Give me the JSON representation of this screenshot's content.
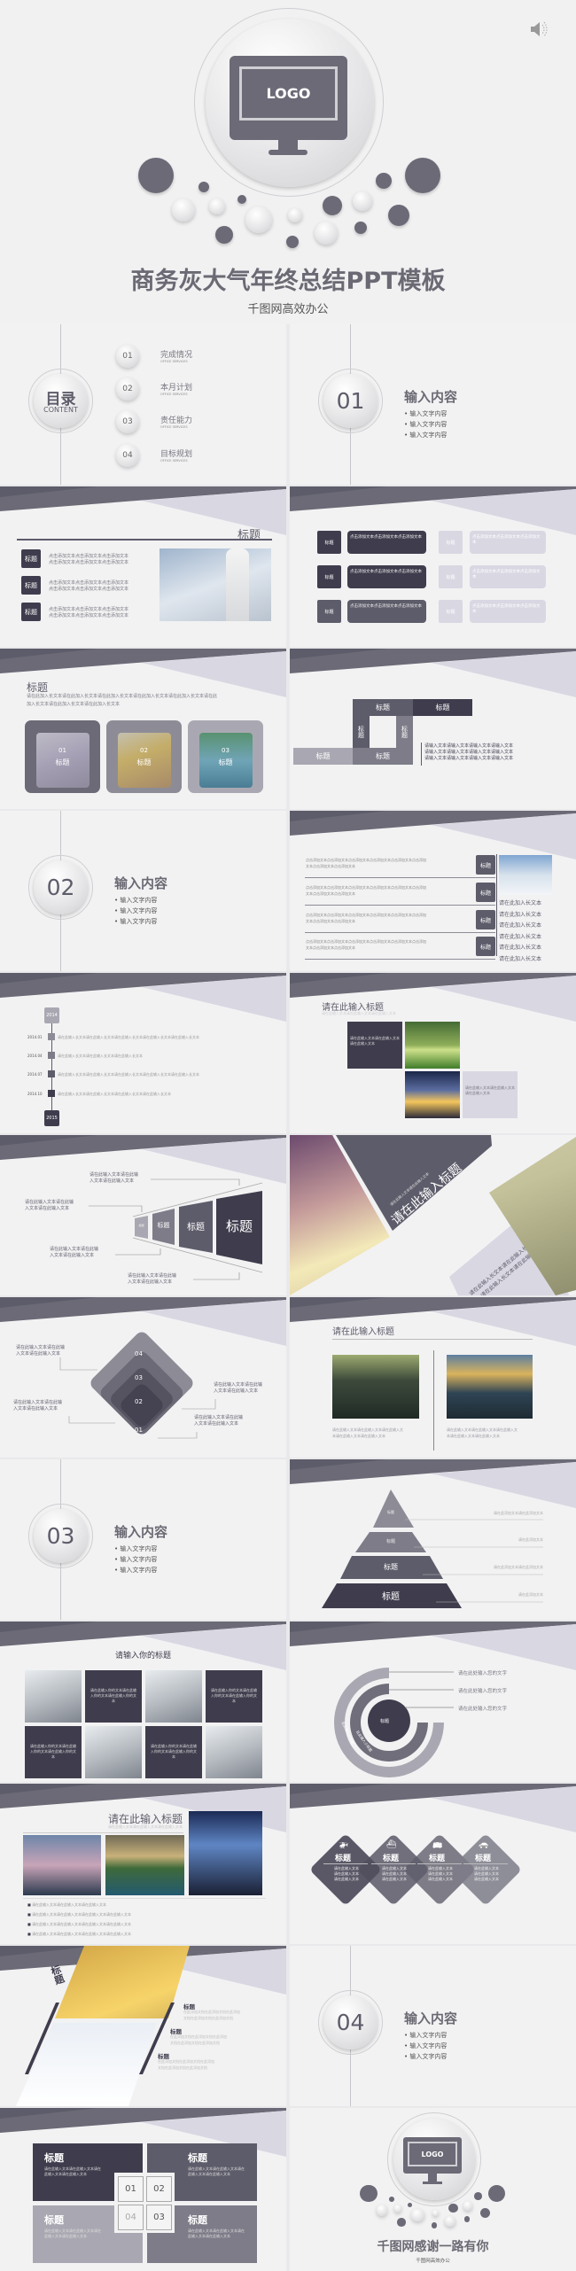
{
  "cover": {
    "logo": "LOGO",
    "title": "商务灰大气年终总结PPT模板",
    "subtitle": "千图网高效办公",
    "speaker_icon": "speaker-icon"
  },
  "colors": {
    "dark": "#3f3d4d",
    "mid": "#5d5c6a",
    "gray": "#7d7c88",
    "light": "#a9a8b2",
    "lavender": "#d9d7e2",
    "background": "#f2f2f3"
  },
  "common": {
    "title": "标题"
  },
  "toc": {
    "title": "目录",
    "subtitle": "CONTENT",
    "items": [
      {
        "num": "01",
        "label": "完成情况",
        "en": "OFFICE SERVICES"
      },
      {
        "num": "02",
        "label": "本月计划",
        "en": "OFFICE SERVICES"
      },
      {
        "num": "03",
        "label": "责任能力",
        "en": "OFFICE SERVICES"
      },
      {
        "num": "04",
        "label": "目标规划",
        "en": "OFFICE SERVICES"
      }
    ]
  },
  "section": {
    "heading": "输入内容",
    "bullet": "• 输入文字内容",
    "nums": [
      "01",
      "02",
      "03",
      "04"
    ]
  },
  "s2": {
    "line": "点击添加文本点击添加文本点击添加文本",
    "box_text": "点击添加文本点击添加文本点击添加文本"
  },
  "s3": {
    "para1": "请在此加入长文本请在此加入长文本请在此加入长文本请在此加入长文本请在此加入长文本请在此",
    "para2": "加入长文本请在此加入长文本请在此加入长文本",
    "cards": [
      "01",
      "02",
      "03"
    ],
    "side": "请输入文本请输入文本请输入文本请输入文本"
  },
  "s4": {
    "row1": "点击添加文本点击添加文本点击添加文本点击添加文本点击添加文本点击添加",
    "row2": "文本点击添加文本点击添加文本",
    "side": "请在此加入长文本"
  },
  "s5": {
    "start": "2014",
    "end": "2015",
    "events": [
      {
        "date": "2014.01",
        "text": "请在此输入长文本请在此输入长文本请在此输入长文本请在此输入长文本请在此输入长文本"
      },
      {
        "date": "2014.04",
        "text": "请在此输入长文本请在此输入长文本请在此输入长文本"
      },
      {
        "date": "2014.07",
        "text": "请在此输入长文本请在此输入长文本请在此输入长文本请在此输入长文本请在此输入长文本"
      },
      {
        "date": "2014.10",
        "text": "请在此输入长文本请在此输入长文本请在此输入长文本请在此输入长文本"
      }
    ],
    "title": "请在此输入标题",
    "sub": "请在此输入文本请在此输入文本请在此输入文本",
    "box": "请在此输入文本请在此输入文本请在此输入文本"
  },
  "s6": {
    "callout1": "请在此输入文本请在此输",
    "callout2": "入文本请在此输入文本",
    "title": "请在此输入标题",
    "sub": "请在此输入文本请在此输入文本",
    "long1": "请在此输入长文本请在此输入长",
    "long2": "文本"
  },
  "s7": {
    "levels": [
      "04",
      "03",
      "02",
      "01"
    ],
    "title": "请在此输入标题",
    "cap1": "请在此输入文本请在此输入文本请在此输入文",
    "cap2": "本请在此输入文本请在此输入文本"
  },
  "s8": {
    "pyr_text_long": "请在此添加文本请在此添加文本",
    "pyr_text_short": "请在此添加文本"
  },
  "s9": {
    "title": "请输入你的标题",
    "tile": "请在此输入你的文本请在此输入你的文本请在此输入你的文本",
    "labels": [
      "请在此处输入您的文字",
      "请在此处输入您的文字",
      "请在此处输入您的文字"
    ],
    "arc": "在此输入小标题"
  },
  "s10": {
    "title": "请在此输入标题",
    "sub": "请在此输入文本请在此输入文本请在此输入文本",
    "bullets": [
      "请在此输入文本请在此输入文本请在此输入文本",
      "请在此输入文本请在此输入文本请在此输入文本请在此输入文本",
      "请在此输入文本请在此输入文本请在此输入文本请在此输入文本",
      "请在此输入文本请在此输入文本请在此输入文本请在此输入文本"
    ],
    "diamond_text": "请在此输入文本请在此输入文本请在此输入文本",
    "diamond_icons": [
      "helicopter-icon",
      "ship-icon",
      "bus-icon",
      "car-icon"
    ]
  },
  "s11": {
    "item_text1": "在此添加文档在此添加文档在此添加",
    "item_text2": "文档在此添加文档在此添加文档"
  },
  "s12": {
    "card_text": "请在此输入文本请在此输入文本请在此输入文本请在此输入文本",
    "nums": [
      "01",
      "02",
      "04",
      "03"
    ],
    "thanks": "千图网感谢一路有你",
    "subtitle": "千图网高效办公",
    "logo": "LOGO"
  }
}
